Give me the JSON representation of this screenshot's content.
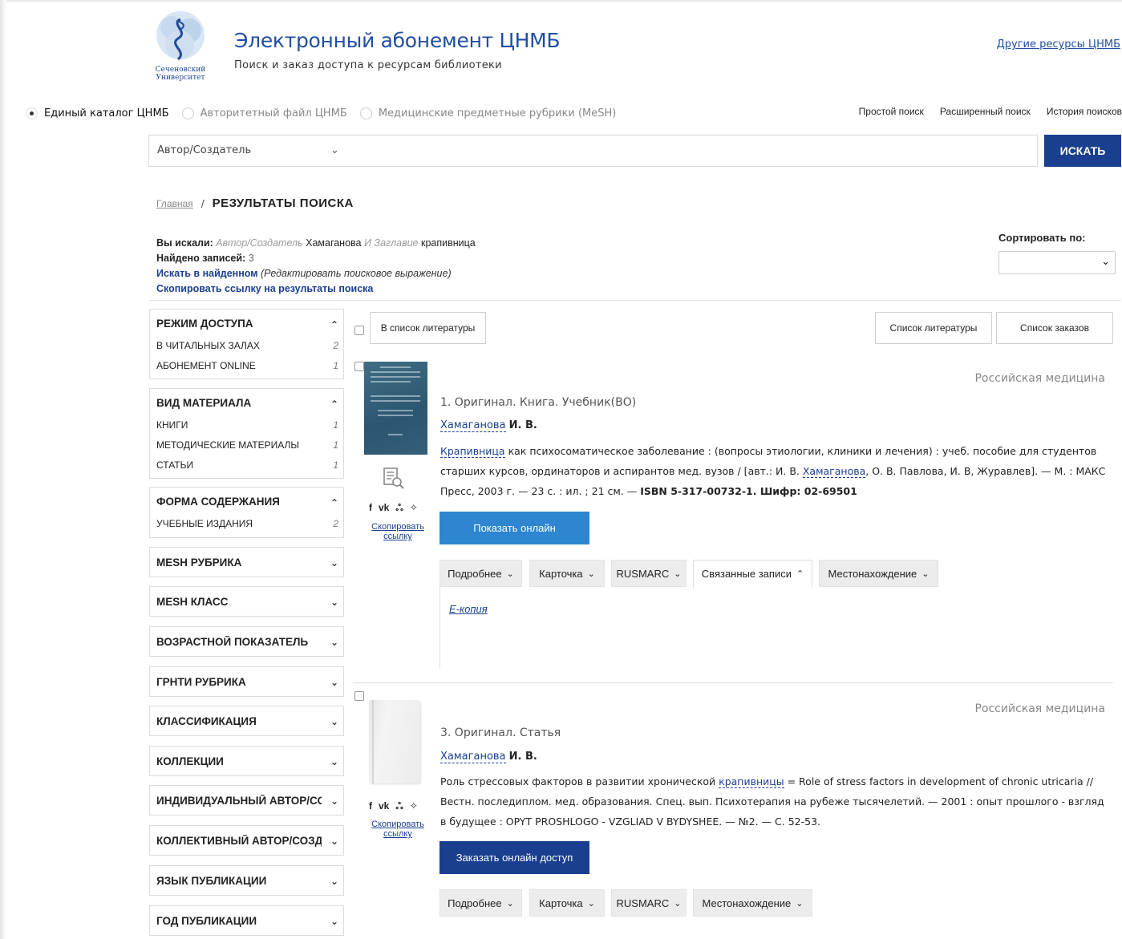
{
  "header": {
    "logo_text_1": "Сеченовский",
    "logo_text_2": "Университет",
    "title": "Электронный абонемент ЦНМБ",
    "subtitle": "Поиск и заказ доступа к ресурсам библиотеки",
    "other_resources": "Другие ресурсы ЦНМБ"
  },
  "catalogs": [
    {
      "label": "Единый каталог ЦНМБ",
      "selected": true
    },
    {
      "label": "Авторитетный файл ЦНМБ",
      "selected": false
    },
    {
      "label": "Медицинские предметные рубрики (MeSH)",
      "selected": false
    }
  ],
  "search_modes": [
    "Простой поиск",
    "Расширенный поиск",
    "История поисков"
  ],
  "search": {
    "field": "Автор/Создатель",
    "button": "ИСКАТЬ"
  },
  "breadcrumb": {
    "home": "Главная",
    "sep": "/",
    "current": "РЕЗУЛЬТАТЫ ПОИСКА"
  },
  "query": {
    "you_searched_label": "Вы искали:",
    "field1": "Автор/Создатель",
    "value1": "Хамаганова",
    "op": "И",
    "field2": "Заглавие",
    "value2": "крапивница",
    "found_label": "Найдено записей:",
    "found_count": "3",
    "search_within": "Искать в найденном",
    "edit_query": "(Редактировать поисковое выражение)",
    "copy_results_link": "Скопировать ссылку на результаты поиска"
  },
  "sort": {
    "label": "Сортировать по:",
    "value": ""
  },
  "facets": [
    {
      "title": "РЕЖИМ ДОСТУПА",
      "expanded": true,
      "items": [
        {
          "label": "В читальных залах",
          "count": "2"
        },
        {
          "label": "Абонемент online",
          "count": "1"
        }
      ]
    },
    {
      "title": "ВИД МАТЕРИАЛА",
      "expanded": true,
      "items": [
        {
          "label": "Книги",
          "count": "1"
        },
        {
          "label": "Методические материалы",
          "count": "1"
        },
        {
          "label": "Статьи",
          "count": "1"
        }
      ]
    },
    {
      "title": "ФОРМА СОДЕРЖАНИЯ",
      "expanded": true,
      "items": [
        {
          "label": "Учебные издания",
          "count": "2"
        }
      ]
    },
    {
      "title": "MESH РУБРИКА",
      "expanded": false,
      "items": []
    },
    {
      "title": "MESH КЛАСС",
      "expanded": false,
      "items": []
    },
    {
      "title": "ВОЗРАСТНОЙ ПОКАЗАТЕЛЬ",
      "expanded": false,
      "items": []
    },
    {
      "title": "ГРНТИ РУБРИКА",
      "expanded": false,
      "items": []
    },
    {
      "title": "КЛАССИФИКАЦИЯ",
      "expanded": false,
      "items": []
    },
    {
      "title": "КОЛЛЕКЦИИ",
      "expanded": false,
      "items": []
    },
    {
      "title": "ИНДИВИДУАЛЬНЫЙ АВТОР/СОЗДАТЕЛЬ",
      "expanded": false,
      "items": []
    },
    {
      "title": "КОЛЛЕКТИВНЫЙ АВТОР/СОЗДАТЕЛЬ",
      "expanded": false,
      "items": []
    },
    {
      "title": "ЯЗЫК ПУБЛИКАЦИИ",
      "expanded": false,
      "items": []
    },
    {
      "title": "ГОД ПУБЛИКАЦИИ",
      "expanded": false,
      "items": []
    }
  ],
  "toolbar": {
    "add_to_list": "В список литературы",
    "bibliography": "Список литературы",
    "orders": "Список заказов"
  },
  "records": [
    {
      "source": "Российская медицина",
      "type": "1. Оригинал. Книга. Учебник(ВО)",
      "author_link": "Хамаганова",
      "author_initials": "И. В.",
      "desc_link1": "Крапивница",
      "desc_part1": " как психосоматическое заболевание : (вопросы этиологии, клиники и лечения) : учеб. пособие для студентов старших курсов, ординаторов и аспирантов мед. вузов / [авт.: И. В. ",
      "desc_link2": "Хамаганова",
      "desc_part2": ", О. В. Павлова, И. В, Журавлев]. — М. : МАКС Пресс, 2003 г. — 23 с. : ил. ; 21 см. — ",
      "desc_bold": "ISBN 5-317-00732-1. Шифр: 02-69501",
      "action": "Показать онлайн",
      "tabs": [
        "Подробнее",
        "Карточка",
        "RUSMARC",
        "Связанные записи",
        "Местонахождение"
      ],
      "active_tab": "Связанные записи",
      "related": "Е-копия",
      "copy_link": "Скопировать ссылку"
    },
    {
      "source": "Российская медицина",
      "type": "3. Оригинал. Статья",
      "author_link": "Хамаганова",
      "author_initials": "И. В.",
      "desc_part1": "Роль стрессовых факторов в развитии хронической ",
      "desc_link1": "крапивницы",
      "desc_part2": " = Role of stress factors in development of chronic utricaria // Вестн. последиплом. мед. образования. Спец. вып. Психотерапия на рубеже тысячелетий. — 2001 : опыт прошлого - взгляд в будущее : OPYT PROSHLOGO - VZGLIAD V BYDYSHEE. — №2. — С. 52-53.",
      "action": "Заказать онлайн доступ",
      "tabs": [
        "Подробнее",
        "Карточка",
        "RUSMARC",
        "Местонахождение"
      ],
      "copy_link": "Скопировать ссылку"
    }
  ],
  "social_icons": [
    "facebook-icon",
    "vk-icon",
    "odnoklassniki-icon",
    "twitter-icon"
  ],
  "colors": {
    "brand_blue": "#1a3f8f",
    "title_blue": "#1e4fa3",
    "show_online": "#2d86cf"
  }
}
